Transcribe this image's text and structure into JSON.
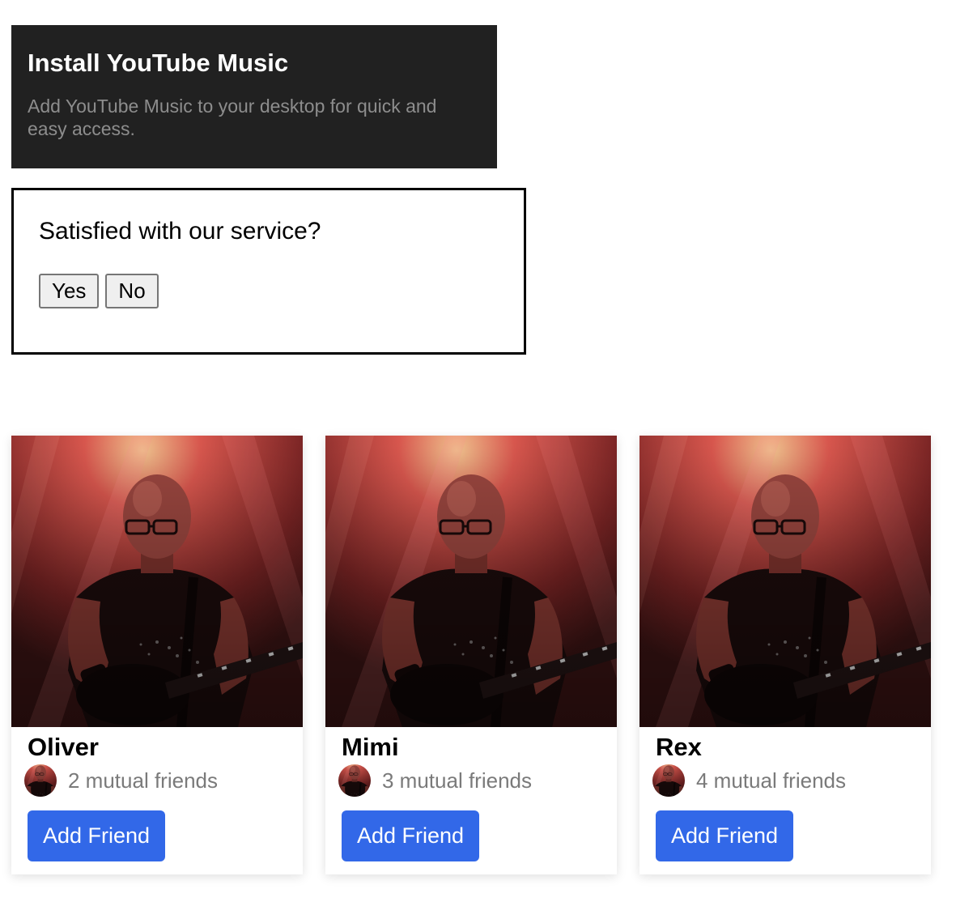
{
  "install_banner": {
    "title": "Install YouTube Music",
    "description": "Add YouTube Music to your desktop for quick and easy access."
  },
  "survey": {
    "question": "Satisfied with our service?",
    "yes_label": "Yes",
    "no_label": "No"
  },
  "friends": [
    {
      "name": "Oliver",
      "mutual": "2 mutual friends",
      "button_label": "Add Friend"
    },
    {
      "name": "Mimi",
      "mutual": "3 mutual friends",
      "button_label": "Add Friend"
    },
    {
      "name": "Rex",
      "mutual": "4 mutual friends",
      "button_label": "Add Friend"
    }
  ],
  "colors": {
    "banner_bg": "#212121",
    "button_blue": "#3268e8"
  }
}
